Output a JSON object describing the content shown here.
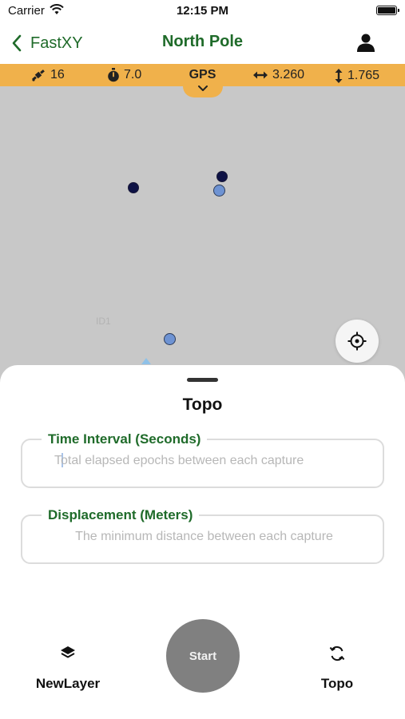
{
  "status_bar": {
    "carrier": "Carrier",
    "time": "12:15 PM"
  },
  "nav": {
    "back_label": "FastXY",
    "title": "North Pole"
  },
  "info_strip": {
    "satellites": "16",
    "timer": "7.0",
    "mode": "GPS",
    "horizontal": "3.260",
    "vertical": "1.765"
  },
  "map": {
    "faint_label": "ID1"
  },
  "sheet": {
    "title": "Topo",
    "time_interval": {
      "label": "Time Interval (Seconds)",
      "placeholder": "Total elapsed epochs between each capture",
      "value": ""
    },
    "displacement": {
      "label": "Displacement (Meters)",
      "placeholder": "The minimum distance between each capture",
      "value": ""
    }
  },
  "bottom_bar": {
    "new_layer_label": "NewLayer",
    "start_label": "Start",
    "topo_label": "Topo"
  },
  "colors": {
    "accent_green": "#1f6b2a",
    "strip_orange": "#f0b14b",
    "map_gray": "#c8c8c8",
    "start_gray": "#808080",
    "point_dark": "#0e1245",
    "point_light": "#6e93d3"
  }
}
